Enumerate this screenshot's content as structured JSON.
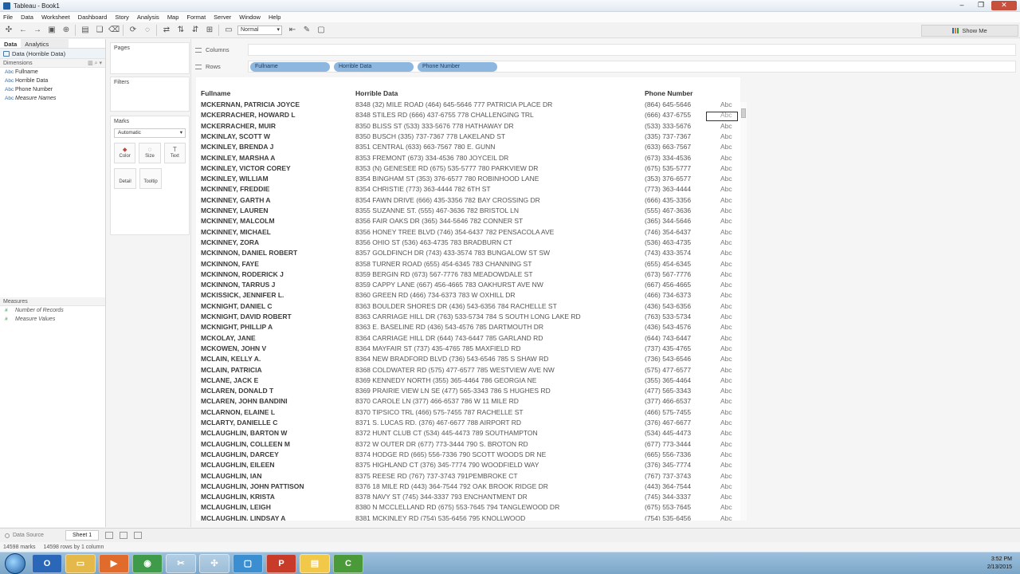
{
  "window": {
    "title": "Tableau - Book1"
  },
  "menu": [
    "File",
    "Data",
    "Worksheet",
    "Dashboard",
    "Story",
    "Analysis",
    "Map",
    "Format",
    "Server",
    "Window",
    "Help"
  ],
  "toolbar": {
    "mark_type": "Normal",
    "show_me": "Show Me"
  },
  "left_pane": {
    "tabs": [
      "Data",
      "Analytics"
    ],
    "datasource": "Data (Horrible Data)",
    "dimensions_header": "Dimensions",
    "dimensions": [
      "Fullname",
      "Horrible Data",
      "Phone Number",
      "Measure Names"
    ],
    "measures_header": "Measures",
    "measures": [
      "Number of Records",
      "Measure Values"
    ]
  },
  "cards": {
    "pages": "Pages",
    "filters": "Filters",
    "marks": "Marks",
    "marks_type": "Automatic",
    "mark_buttons": [
      "Color",
      "Size",
      "Text",
      "Detail",
      "Tooltip"
    ]
  },
  "shelves": {
    "columns_label": "Columns",
    "rows_label": "Rows",
    "row_pills": [
      "Fullname",
      "Horrible Data",
      "Phone Number"
    ]
  },
  "table": {
    "headers": [
      "Fullname",
      "Horrible Data",
      "Phone Number"
    ],
    "abc": "Abc",
    "rows": [
      [
        "MCKERNAN, PATRICIA JOYCE",
        "8348 (32) MILE ROAD (464) 645-5646 777 PATRICIA PLACE DR",
        "(864) 645-5646"
      ],
      [
        "MCKERRACHER, HOWARD L",
        "8348 STILES RD (666) 437-6755 778 CHALLENGING TRL",
        "(666) 437-6755"
      ],
      [
        "MCKERRACHER, MUIR",
        "8350 BLISS ST (533) 333-5676 778 HATHAWAY DR",
        "(533) 333-5676"
      ],
      [
        "MCKINLAY, SCOTT W",
        "8350 BUSCH (335) 737-7367 778 LAKELAND ST",
        "(335) 737-7367"
      ],
      [
        "MCKINLEY, BRENDA J",
        "8351 CENTRAL (633) 663-7567 780 E. GUNN",
        "(633) 663-7567"
      ],
      [
        "MCKINLEY, MARSHA A",
        "8353 FREMONT (673) 334-4536 780 JOYCEIL DR",
        "(673) 334-4536"
      ],
      [
        "MCKINLEY, VICTOR COREY",
        "8353 (N) GENESEE RD (675) 535-5777 780 PARKVIEW DR",
        "(675) 535-5777"
      ],
      [
        "MCKINLEY, WILLIAM",
        "8354 BINGHAM ST (353) 376-6577 780 ROBINHOOD LANE",
        "(353) 376-6577"
      ],
      [
        "MCKINNEY, FREDDIE",
        "8354 CHRISTIE (773) 363-4444 782 6TH ST",
        "(773) 363-4444"
      ],
      [
        "MCKINNEY, GARTH A",
        "8354 FAWN DRIVE (666) 435-3356 782 BAY CROSSING DR",
        "(666) 435-3356"
      ],
      [
        "MCKINNEY, LAUREN",
        "8355 SUZANNE ST. (555) 467-3636 782 BRISTOL LN",
        "(555) 467-3636"
      ],
      [
        "MCKINNEY, MALCOLM",
        "8356 FAIR OAKS DR (365) 344-5646 782 CONNER ST",
        "(365) 344-5646"
      ],
      [
        "MCKINNEY, MICHAEL",
        "8356 HONEY TREE BLVD (746) 354-6437 782 PENSACOLA AVE",
        "(746) 354-6437"
      ],
      [
        "MCKINNEY, ZORA",
        "8356 OHIO ST (536) 463-4735 783 BRADBURN CT",
        "(536) 463-4735"
      ],
      [
        "MCKINNON, DANIEL ROBERT",
        "8357 GOLDFINCH DR (743) 433-3574 783 BUNGALOW ST SW",
        "(743) 433-3574"
      ],
      [
        "MCKINNON, FAYE",
        "8358 TURNER ROAD (655) 454-6345 783 CHANNING ST",
        "(655) 454-6345"
      ],
      [
        "MCKINNON, RODERICK J",
        "8359 BERGIN RD (673) 567-7776 783 MEADOWDALE ST",
        "(673) 567-7776"
      ],
      [
        "MCKINNON, TARRUS J",
        "8359 CAPPY LANE (667) 456-4665 783 OAKHURST AVE NW",
        "(667) 456-4665"
      ],
      [
        "MCKISSICK, JENNIFER L.",
        "8360 GREEN RD (466) 734-6373 783 W OXHILL DR",
        "(466) 734-6373"
      ],
      [
        "MCKNIGHT, DANIEL C",
        "8363 BOULDER SHORES DR (436) 543-6356 784 RACHELLE ST",
        "(436) 543-6356"
      ],
      [
        "MCKNIGHT, DAVID ROBERT",
        "8363 CARRIAGE HILL DR (763) 533-5734 784 S SOUTH LONG LAKE RD",
        "(763) 533-5734"
      ],
      [
        "MCKNIGHT, PHILLIP A",
        "8363 E. BASELINE RD (436) 543-4576 785 DARTMOUTH DR",
        "(436) 543-4576"
      ],
      [
        "MCKOLAY, JANE",
        "8364 CARRIAGE HILL DR (644) 743-6447 785 GARLAND RD",
        "(644) 743-6447"
      ],
      [
        "MCKOWEN, JOHN V",
        "8364 MAYFAIR ST (737) 435-4765 785 MAXFIELD RD",
        "(737) 435-4765"
      ],
      [
        "MCLAIN, KELLY A.",
        "8364 NEW BRADFORD BLVD (736) 543-6546 785 S SHAW RD",
        "(736) 543-6546"
      ],
      [
        "MCLAIN, PATRICIA",
        "8368 COLDWATER RD (575) 477-6577 785 WESTVIEW AVE NW",
        "(575) 477-6577"
      ],
      [
        "MCLANE, JACK E",
        "8369 KENNEDY NORTH (355) 365-4464 786 GEORGIA NE",
        "(355) 365-4464"
      ],
      [
        "MCLAREN, DONALD T",
        "8369 PRAIRIE VIEW LN SE (477) 565-3343 786 S HUGHES RD",
        "(477) 565-3343"
      ],
      [
        "MCLAREN, JOHN BANDINI",
        "8370 CAROLE LN (377) 466-6537 786 W 11 MILE RD",
        "(377) 466-6537"
      ],
      [
        "MCLARNON, ELAINE L",
        "8370 TIPSICO TRL (466) 575-7455 787 RACHELLE ST",
        "(466) 575-7455"
      ],
      [
        "MCLARTY, DANIELLE C",
        "8371 S. LUCAS RD. (376) 467-6677 788 AIRPORT RD",
        "(376) 467-6677"
      ],
      [
        "MCLAUGHLIN, BARTON W",
        "8372 HUNT CLUB CT (534) 445-4473 789 SOUTHAMPTON",
        "(534) 445-4473"
      ],
      [
        "MCLAUGHLIN, COLLEEN M",
        "8372 W OUTER DR (677) 773-3444 790 S. BROTON RD",
        "(677) 773-3444"
      ],
      [
        "MCLAUGHLIN, DARCEY",
        "8374 HODGE RD (665) 556-7336 790 SCOTT WOODS DR NE",
        "(665) 556-7336"
      ],
      [
        "MCLAUGHLIN, EILEEN",
        "8375 HIGHLAND CT (376) 345-7774 790 WOODFIELD WAY",
        "(376) 345-7774"
      ],
      [
        "MCLAUGHLIN, IAN",
        "8375 REESE RD (767) 737-3743 791PEMBROKE CT",
        "(767) 737-3743"
      ],
      [
        "MCLAUGHLIN, JOHN PATTISON",
        "8376 18 MILE RD (443) 364-7544 792 OAK BROOK RIDGE DR",
        "(443) 364-7544"
      ],
      [
        "MCLAUGHLIN, KRISTA",
        "8378 NAVY ST (745) 344-3337 793 ENCHANTMENT DR",
        "(745) 344-3337"
      ],
      [
        "MCLAUGHLIN, LEIGH",
        "8380 N MCCLELLAND RD (675) 553-7645 794 TANGLEWOOD DR",
        "(675) 553-7645"
      ],
      [
        "MCLAUGHLIN, LINDSAY A",
        "8381 MCKINLEY RD (754) 535-6456 795 KNOLLWOOD",
        "(754) 535-6456"
      ]
    ]
  },
  "bottom": {
    "data_source_tab": "Data Source",
    "sheet_tab": "Sheet 1",
    "status_marks": "14598 marks",
    "status_rows": "14598 rows by 1 column"
  },
  "taskbar": {
    "time": "3:52 PM",
    "date": "2/13/2015"
  }
}
